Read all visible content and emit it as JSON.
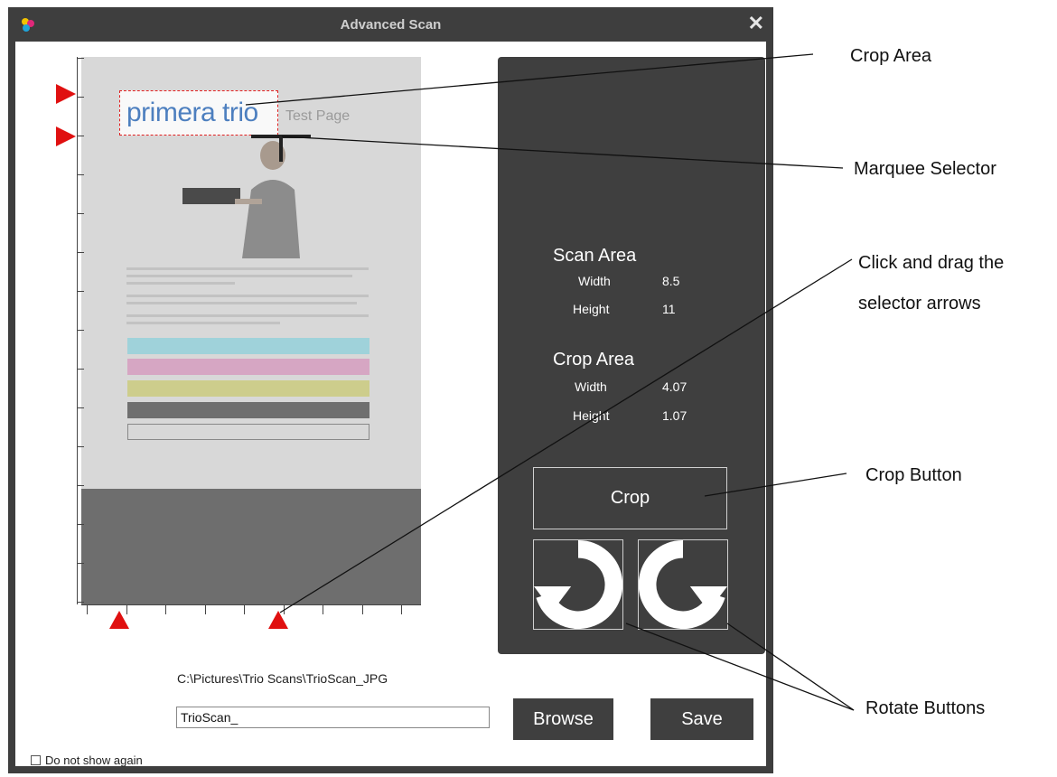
{
  "window": {
    "title": "Advanced Scan",
    "close_label": "✕",
    "logo_icon": "app-logo-icon"
  },
  "preview": {
    "logo_primary": "primera",
    "logo_secondary": "trio",
    "test_page": "Test Page",
    "colors": {
      "cyan": "#9fd2da",
      "magenta": "#d6a6c3",
      "yellow": "#cdcd8c",
      "black": "#6f6f6f"
    }
  },
  "scan_area": {
    "heading": "Scan Area",
    "width_label": "Width",
    "width_value": "8.5",
    "height_label": "Height",
    "height_value": "11"
  },
  "crop_area": {
    "heading": "Crop Area",
    "width_label": "Width",
    "width_value": "4.07",
    "height_label": "Height",
    "height_value": "1.07"
  },
  "buttons": {
    "crop": "Crop",
    "browse": "Browse",
    "save": "Save",
    "rotate_left_icon": "rotate-left-icon",
    "rotate_right_icon": "rotate-right-icon"
  },
  "output": {
    "path": "C:\\Pictures\\Trio Scans\\TrioScan_JPG",
    "filename": "TrioScan_"
  },
  "footer": {
    "do_not_show": "Do not show again"
  },
  "callouts": {
    "crop_area": "Crop Area",
    "marquee_selector": "Marquee Selector",
    "drag_line1": "Click and drag the",
    "drag_line2": "selector arrows",
    "crop_button": "Crop Button",
    "rotate_buttons": "Rotate Buttons"
  },
  "accent_colors": {
    "arrow": "#e01010",
    "panel": "#3f3f3f",
    "titlebar": "#3e3e3e"
  }
}
